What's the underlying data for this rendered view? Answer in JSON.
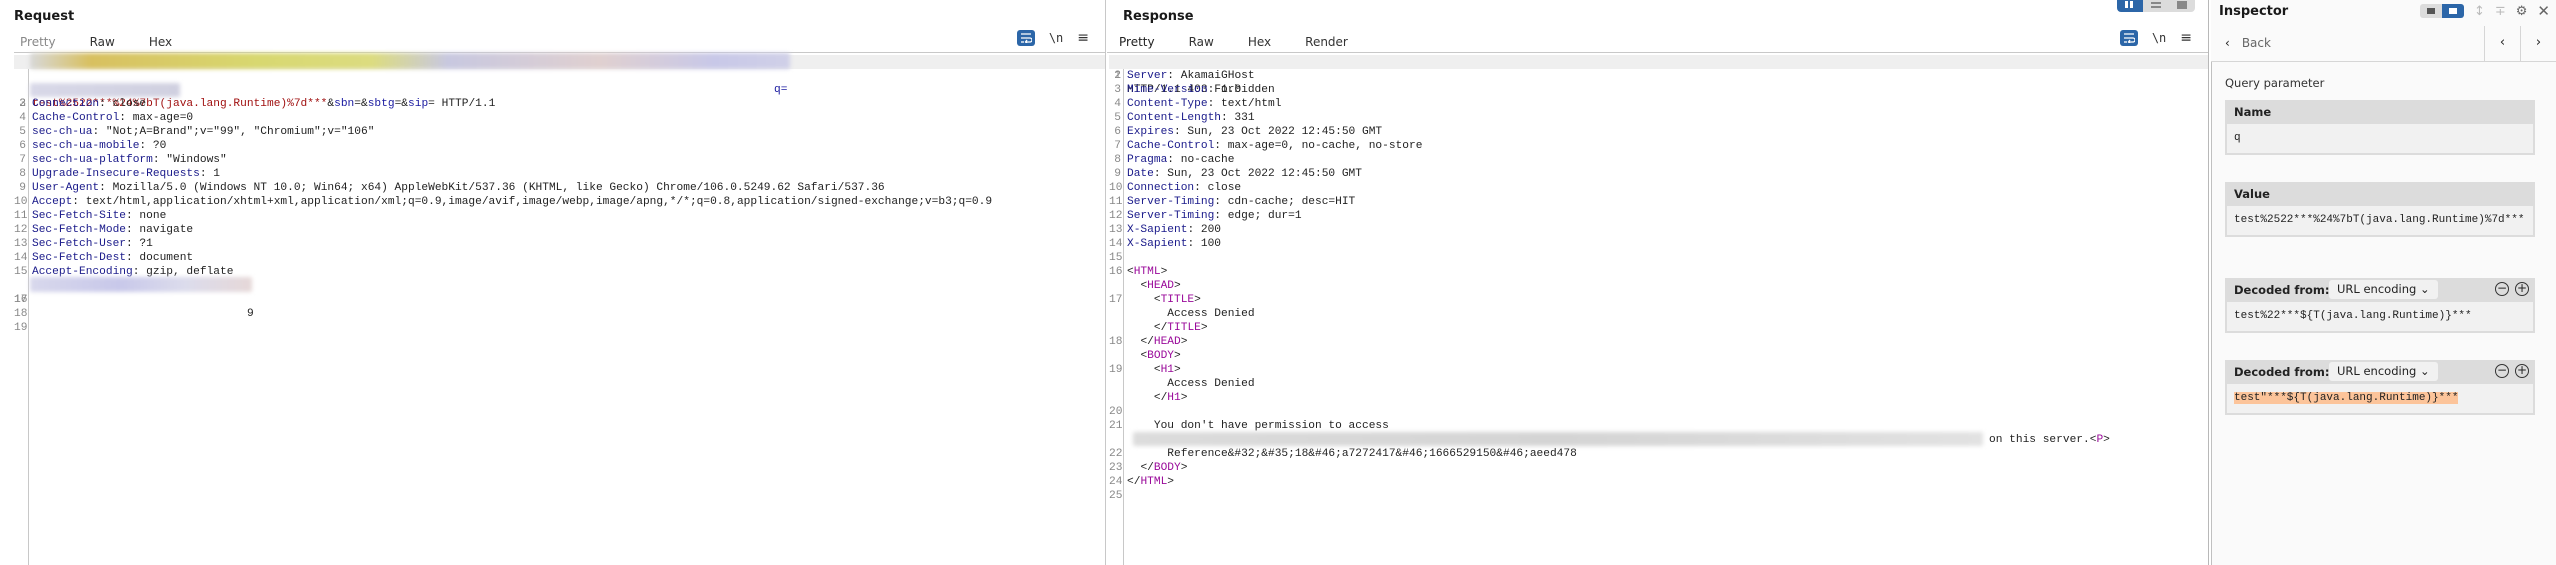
{
  "request": {
    "title": "Request",
    "tabs": [
      {
        "label": "Pretty",
        "active": false
      },
      {
        "label": "Raw",
        "active": false
      },
      {
        "label": "Hex",
        "active": false
      }
    ],
    "tools": {
      "wrap_icon": "wrap-lines-icon",
      "newline_label": "\\n",
      "menu_icon": "hamburger-menu-icon"
    },
    "line1_tail": [
      {
        "text": "test%2522***%24%7bT(java.lang.Runtime)%7d***",
        "cls": "red"
      },
      {
        "text": "&",
        "cls": "plain"
      },
      {
        "text": "sbn",
        "cls": "blue"
      },
      {
        "text": "=&",
        "cls": "plain"
      },
      {
        "text": "sbtg",
        "cls": "blue"
      },
      {
        "text": "=&",
        "cls": "plain"
      },
      {
        "text": "sip",
        "cls": "blue"
      },
      {
        "text": "= HTTP/1.1",
        "cls": "plain"
      }
    ],
    "line1_trailing": "q=",
    "lines": [
      {
        "n": "3",
        "name": "Connection",
        "value": " close"
      },
      {
        "n": "4",
        "name": "Cache-Control",
        "value": " max-age=0"
      },
      {
        "n": "5",
        "name": "sec-ch-ua",
        "value": " \"Not;A=Brand\";v=\"99\", \"Chromium\";v=\"106\""
      },
      {
        "n": "6",
        "name": "sec-ch-ua-mobile",
        "value": " ?0"
      },
      {
        "n": "7",
        "name": "sec-ch-ua-platform",
        "value": " \"Windows\""
      },
      {
        "n": "8",
        "name": "Upgrade-Insecure-Requests",
        "value": " 1"
      },
      {
        "n": "9",
        "name": "User-Agent",
        "value": " Mozilla/5.0 (Windows NT 10.0; Win64; x64) AppleWebKit/537.36 (KHTML, like Gecko) Chrome/106.0.5249.62 Safari/537.36"
      },
      {
        "n": "10",
        "name": "Accept",
        "value": " text/html,application/xhtml+xml,application/xml;q=0.9,image/avif,image/webp,image/apng,*/*;q=0.8,application/signed-exchange;v=b3;q=0.9"
      },
      {
        "n": "11",
        "name": "Sec-Fetch-Site",
        "value": " none"
      },
      {
        "n": "12",
        "name": "Sec-Fetch-Mode",
        "value": " navigate"
      },
      {
        "n": "13",
        "name": "Sec-Fetch-User",
        "value": " ?1"
      },
      {
        "n": "14",
        "name": "Sec-Fetch-Dest",
        "value": " document"
      },
      {
        "n": "15",
        "name": "Accept-Encoding",
        "value": " gzip, deflate"
      }
    ],
    "line16_tail": "9",
    "trailing_line_numbers": [
      "16",
      "17",
      "18",
      "19"
    ]
  },
  "response": {
    "title": "Response",
    "tabs": [
      {
        "label": "Pretty",
        "active": true
      },
      {
        "label": "Raw",
        "active": false
      },
      {
        "label": "Hex",
        "active": false
      },
      {
        "label": "Render",
        "active": false
      }
    ],
    "tools": {
      "wrap_icon": "wrap-lines-icon",
      "newline_label": "\\n",
      "menu_icon": "hamburger-menu-icon"
    },
    "status_line": "HTTP/1.1 403 Forbidden",
    "headers": [
      {
        "n": "2",
        "name": "Server",
        "value": " AkamaiGHost"
      },
      {
        "n": "3",
        "name": "Mime-Version",
        "value": " 1.0"
      },
      {
        "n": "4",
        "name": "Content-Type",
        "value": " text/html"
      },
      {
        "n": "5",
        "name": "Content-Length",
        "value": " 331"
      },
      {
        "n": "6",
        "name": "Expires",
        "value": " Sun, 23 Oct 2022 12:45:50 GMT"
      },
      {
        "n": "7",
        "name": "Cache-Control",
        "value": " max-age=0, no-cache, no-store"
      },
      {
        "n": "8",
        "name": "Pragma",
        "value": " no-cache"
      },
      {
        "n": "9",
        "name": "Date",
        "value": " Sun, 23 Oct 2022 12:45:50 GMT"
      },
      {
        "n": "10",
        "name": "Connection",
        "value": " close"
      },
      {
        "n": "11",
        "name": "Server-Timing",
        "value": " cdn-cache; desc=HIT"
      },
      {
        "n": "12",
        "name": "Server-Timing",
        "value": " edge; dur=1"
      },
      {
        "n": "13",
        "name": "X-Sapient",
        "value": " 200"
      },
      {
        "n": "14",
        "name": "X-Sapient",
        "value": " 100"
      }
    ],
    "body": [
      {
        "n": "15",
        "indent": "",
        "parts": []
      },
      {
        "n": "16",
        "indent": "",
        "parts": [
          [
            "<",
            "plain"
          ],
          [
            "HTML",
            "tag"
          ],
          [
            ">",
            "plain"
          ]
        ]
      },
      {
        "n": "",
        "indent": "  ",
        "parts": [
          [
            "<",
            "plain"
          ],
          [
            "HEAD",
            "tag"
          ],
          [
            ">",
            "plain"
          ]
        ]
      },
      {
        "n": "17",
        "indent": "    ",
        "parts": [
          [
            "<",
            "plain"
          ],
          [
            "TITLE",
            "tag"
          ],
          [
            ">",
            "plain"
          ]
        ]
      },
      {
        "n": "",
        "indent": "      ",
        "parts": [
          [
            "Access Denied",
            "plain"
          ]
        ]
      },
      {
        "n": "",
        "indent": "    ",
        "parts": [
          [
            "</",
            "plain"
          ],
          [
            "TITLE",
            "tag"
          ],
          [
            ">",
            "plain"
          ]
        ]
      },
      {
        "n": "18",
        "indent": "  ",
        "parts": [
          [
            "</",
            "plain"
          ],
          [
            "HEAD",
            "tag"
          ],
          [
            ">",
            "plain"
          ]
        ]
      },
      {
        "n": "",
        "indent": "  ",
        "parts": [
          [
            "<",
            "plain"
          ],
          [
            "BODY",
            "tag"
          ],
          [
            ">",
            "plain"
          ]
        ]
      },
      {
        "n": "19",
        "indent": "    ",
        "parts": [
          [
            "<",
            "plain"
          ],
          [
            "H1",
            "tag"
          ],
          [
            ">",
            "plain"
          ]
        ]
      },
      {
        "n": "",
        "indent": "      ",
        "parts": [
          [
            "Access Denied",
            "plain"
          ]
        ]
      },
      {
        "n": "",
        "indent": "    ",
        "parts": [
          [
            "</",
            "plain"
          ],
          [
            "H1",
            "tag"
          ],
          [
            ">",
            "plain"
          ]
        ]
      },
      {
        "n": "20",
        "indent": "",
        "parts": []
      },
      {
        "n": "21",
        "indent": "    ",
        "parts": [
          [
            "You don't have permission to access",
            "plain"
          ]
        ]
      },
      {
        "n": "",
        "indent": "",
        "parts": [],
        "tail": [
          [
            "on this server.",
            "plain"
          ],
          [
            "<",
            "plain"
          ],
          [
            "P",
            "tag"
          ],
          [
            ">",
            "plain"
          ]
        ]
      },
      {
        "n": "22",
        "indent": "      ",
        "parts": [
          [
            "Reference&#32;&#35;18&#46;a7272417&#46;1666529150&#46;aeed478",
            "plain"
          ]
        ]
      },
      {
        "n": "23",
        "indent": "  ",
        "parts": [
          [
            "</",
            "plain"
          ],
          [
            "BODY",
            "tag"
          ],
          [
            ">",
            "plain"
          ]
        ]
      },
      {
        "n": "24",
        "indent": "",
        "parts": [
          [
            "</",
            "plain"
          ],
          [
            "HTML",
            "tag"
          ],
          [
            ">",
            "plain"
          ]
        ]
      },
      {
        "n": "25",
        "indent": "",
        "parts": []
      }
    ]
  },
  "inspector": {
    "title": "Inspector",
    "back_label": "Back",
    "section_label": "Query parameter",
    "name_header": "Name",
    "name_value": "q",
    "value_header": "Value",
    "value_value": "test%2522***%24%7bT(java.lang.Runtime)%7d***",
    "decoded": [
      {
        "header": "Decoded from:",
        "encoding": "URL encoding",
        "value": "test%22***${T(java.lang.Runtime)}***",
        "highlight": false
      },
      {
        "header": "Decoded from:",
        "encoding": "URL encoding",
        "value": "test\"***${T(java.lang.Runtime)}***",
        "highlight": true
      }
    ],
    "highlight_color": "#fcc49a"
  },
  "colors": {
    "accent": "#2c66a8",
    "active_tab": "#e8643c",
    "header_name": "#1a1a8a",
    "tag": "#9a0a9a",
    "param_value": "#a01010"
  }
}
